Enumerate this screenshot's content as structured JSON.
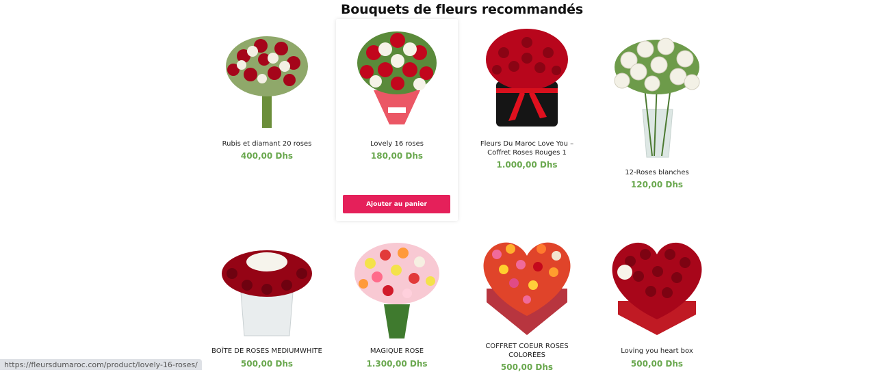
{
  "section_title": "Bouquets de fleurs recommandés",
  "products": [
    {
      "name": "Rubis et diamant 20 roses",
      "price": "400,00 Dhs"
    },
    {
      "name": "Lovely 16 roses",
      "price": "180,00 Dhs",
      "cart_label": "Ajouter au panier"
    },
    {
      "name": "Fleurs Du Maroc Love You – Coffret Roses Rouges 1",
      "price": "1.000,00 Dhs"
    },
    {
      "name": "12-Roses blanches",
      "price": "120,00 Dhs"
    },
    {
      "name": "BOÎTE DE ROSES MEDIUMWHITE",
      "price": "500,00 Dhs"
    },
    {
      "name": "MAGIQUE ROSE",
      "price": "1.300,00 Dhs"
    },
    {
      "name": "COFFRET COEUR ROSES COLORÉES",
      "price": "500,00 Dhs"
    },
    {
      "name": "Loving you heart box",
      "price": "500,00 Dhs"
    }
  ],
  "status_bar_url": "https://fleursdumaroc.com/product/lovely-16-roses/",
  "colors": {
    "price": "#6aa84f",
    "cart_button": "#e5205a",
    "rose_red": "#b3061c",
    "rose_white": "#f4f1e6"
  }
}
